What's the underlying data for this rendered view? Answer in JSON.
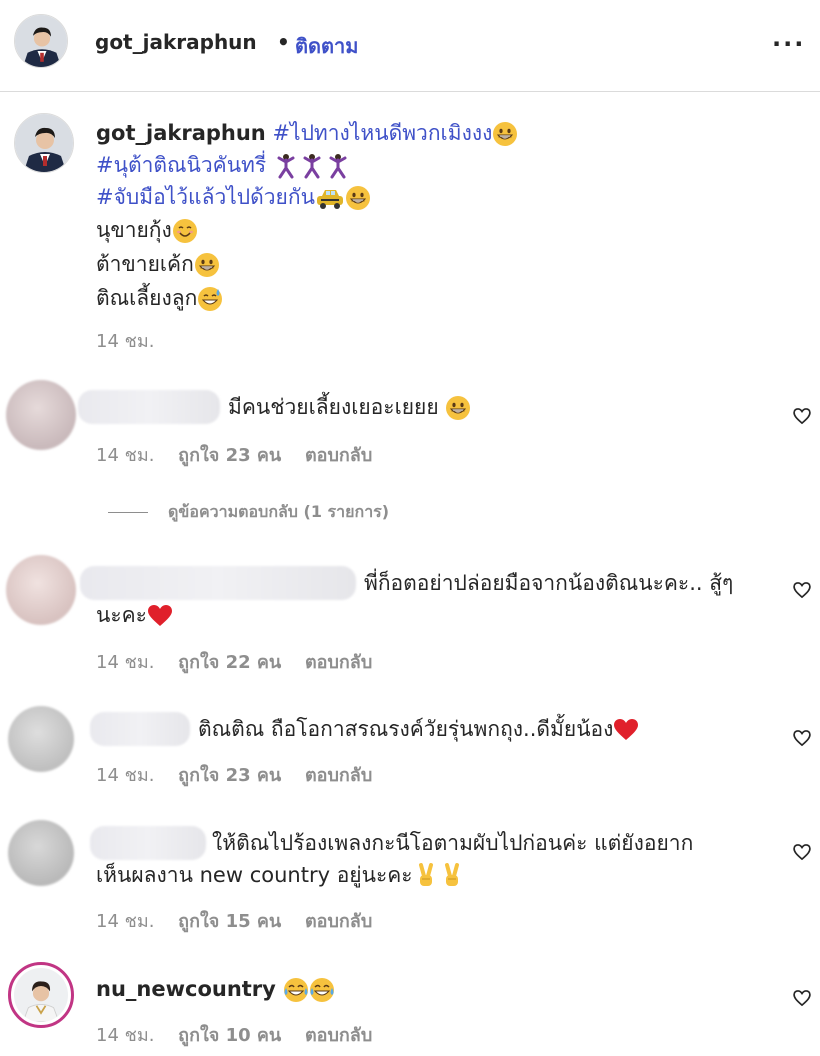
{
  "post": {
    "username": "got_jakraphun",
    "separator": "•",
    "follow_label": "ติดตาม",
    "more_label": "..."
  },
  "caption": {
    "username": "got_jakraphun",
    "line1_tag": "#ไปทางไหนดีพวกเมิงงง",
    "line2_tag": "#นุต้าติณนิวคันทรี่",
    "line3_tag": "#จับมือไว้แล้วไปด้วยกัน",
    "line4": "นุขายกุ้ง",
    "line5": "ต้าขายเค้ก",
    "line6": "ติณเลี้ยงลูก",
    "time": "14 ชม."
  },
  "comments": [
    {
      "text": "มีคนช่วยเลี้ยงเยอะเยยย",
      "time": "14 ชม.",
      "likes": "ถูกใจ 23 คน",
      "reply": "ตอบกลับ"
    },
    {
      "text_line1": "พี่ก็อตอย่าปล่อยมือจากน้องติณนะคะ.. สู้ๆ",
      "text_line2": "นะคะ",
      "time": "14 ชม.",
      "likes": "ถูกใจ 22 คน",
      "reply": "ตอบกลับ"
    },
    {
      "text": "ติณติณ ถือโอกาสรณรงค์วัยรุ่นพกถุง..ดีมั้ยน้อง",
      "time": "14 ชม.",
      "likes": "ถูกใจ 23 คน",
      "reply": "ตอบกลับ"
    },
    {
      "text_line1": "ให้ติณไปร้องเพลงกะนีโอตามผับไปก่อนค่ะ แต่ยังอยาก",
      "text_line2": "เห็นผลงาน new country อยู่นะคะ",
      "time": "14 ชม.",
      "likes": "ถูกใจ 15 คน",
      "reply": "ตอบกลับ"
    },
    {
      "username": "nu_newcountry",
      "time": "14 ชม.",
      "likes": "ถูกใจ 10 คน",
      "reply": "ตอบกลับ"
    }
  ],
  "view_replies_label": "ดูข้อความตอบกลับ (1 รายการ)",
  "colors": {
    "link_blue": "#3f51c8",
    "meta_gray": "#8e8e8e",
    "heart_red": "#e0202b",
    "story_ring": "#c13584"
  },
  "icons": [
    "more-icon",
    "heart-outline-icon",
    "grin-emoji",
    "smile-emoji",
    "sweat-smile-emoji",
    "dancer-emoji",
    "car-emoji",
    "red-heart-emoji",
    "victory-hand-emoji",
    "tears-of-joy-emoji"
  ]
}
